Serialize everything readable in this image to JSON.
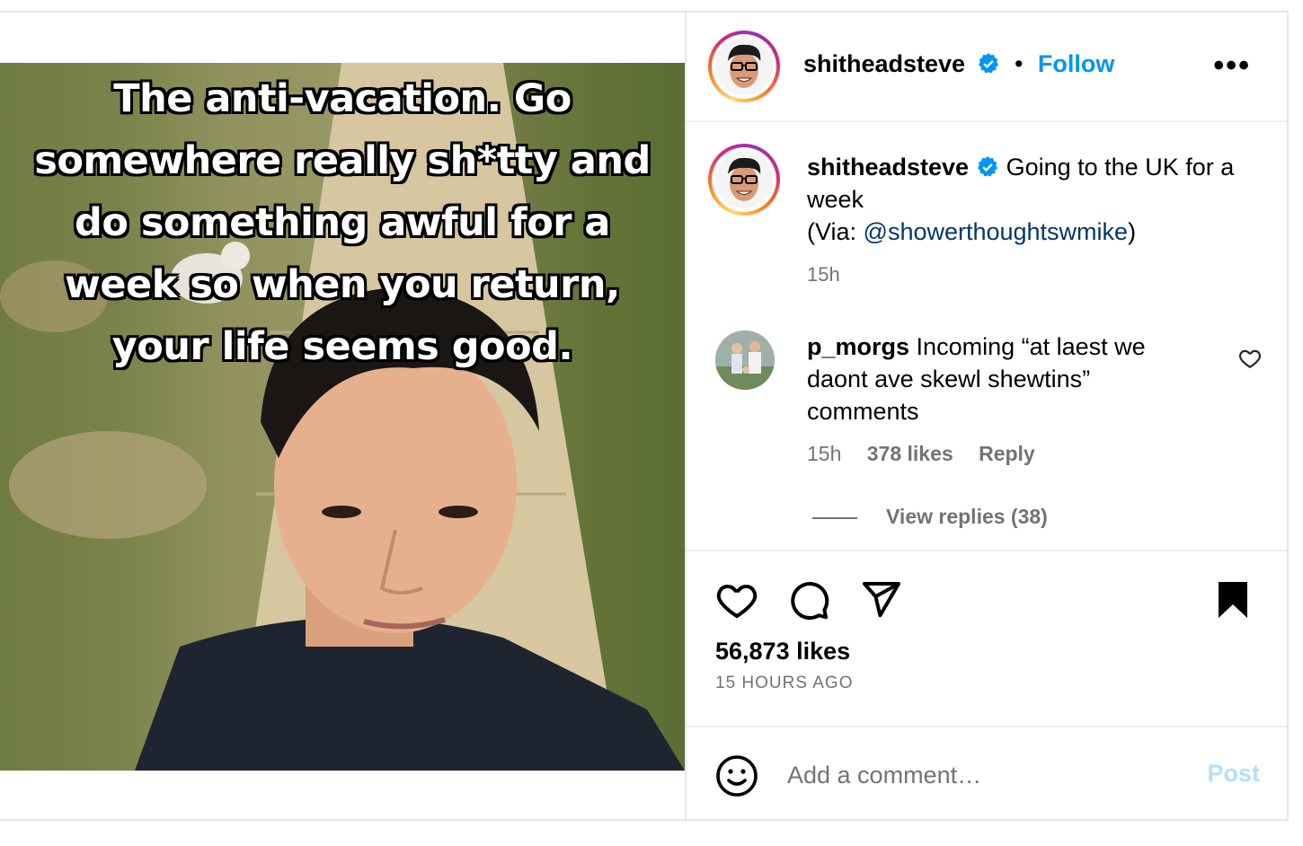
{
  "media": {
    "caption_lines": [
      "The anti-vacation. Go",
      "somewhere really sh*tty and",
      "do something awful for a",
      "week so when you return,",
      "your life seems good."
    ]
  },
  "header": {
    "username": "shitheadsteve",
    "separator": "•",
    "follow_label": "Follow",
    "more_label": "•••"
  },
  "caption": {
    "username": "shitheadsteve",
    "text": "Going to the UK for a week",
    "via_prefix": "(Via: ",
    "via_handle": "@showerthoughtswmike",
    "via_suffix": ")",
    "time": "15h"
  },
  "comment": {
    "username": "p_morgs",
    "text": "Incoming “at laest we daont ave skewl shewtins” comments",
    "time": "15h",
    "likes": "378 likes",
    "reply_label": "Reply",
    "view_replies": "View replies (38)"
  },
  "actions": {
    "likes": "56,873 likes",
    "time_ago": "15 HOURS AGO"
  },
  "comment_bar": {
    "placeholder": "Add a comment…",
    "post_label": "Post"
  },
  "colors": {
    "accent": "#0095f6",
    "link": "#00376b",
    "muted": "#737373",
    "post_disabled": "#b2dffc"
  }
}
